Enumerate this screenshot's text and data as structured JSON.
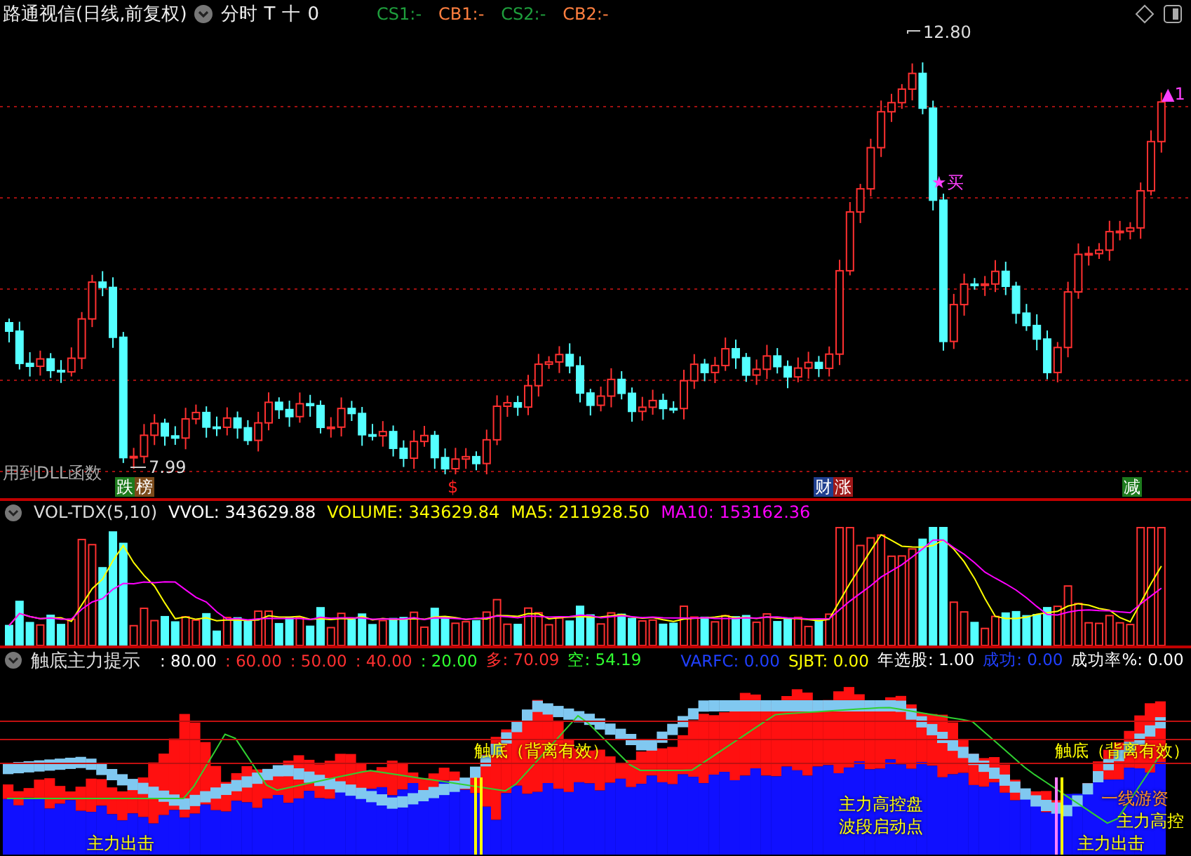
{
  "header": {
    "title": "路通视信(日线,前复权)",
    "tools": [
      "分时",
      "T",
      "十",
      "0"
    ],
    "values": [
      {
        "text": "CS1:-",
        "color": "#1e9e3c"
      },
      {
        "text": "CB1:-",
        "color": "#ff7f3f"
      },
      {
        "text": "CS2:-",
        "color": "#1e9e3c"
      },
      {
        "text": "CB2:-",
        "color": "#ff7f3f"
      }
    ]
  },
  "price_chart": {
    "high_label": "12.80",
    "low_label": "7.99",
    "buy_signal": "★买",
    "up_signal": "▲1",
    "note": "用到DLL函数",
    "markers": [
      {
        "kind": "badge",
        "text": "跌",
        "color": "#1d7a1d"
      },
      {
        "kind": "badge",
        "text": "榜",
        "color": "#7a4a1a"
      },
      {
        "kind": "plain",
        "text": "$",
        "color": "#ff2020"
      },
      {
        "kind": "badge",
        "text": "财",
        "color": "#1f3f8f"
      },
      {
        "kind": "badge",
        "text": "涨",
        "color": "#a01818"
      },
      {
        "kind": "badge",
        "text": "减",
        "color": "#1d7a1d"
      }
    ]
  },
  "volume_panel": {
    "title": "VOL-TDX(5,10)",
    "readouts": [
      {
        "text": "VVOL: 343629.88",
        "color": "#ffffff"
      },
      {
        "text": "VOLUME: 343629.84",
        "color": "#ffff00"
      },
      {
        "text": "MA5: 211928.50",
        "color": "#ffff00"
      },
      {
        "text": "MA10: 153162.36",
        "color": "#ff00ff"
      }
    ]
  },
  "indicator_panel": {
    "title": "触底主力提示",
    "readouts": [
      {
        "text": ": 80.00",
        "color": "#ffffff"
      },
      {
        "text": ": 60.00",
        "color": "#ff3030"
      },
      {
        "text": ": 50.00",
        "color": "#ff3030"
      },
      {
        "text": ": 40.00",
        "color": "#ff3030"
      },
      {
        "text": ": 20.00",
        "color": "#30ff30"
      },
      {
        "text": "多: 70.09",
        "color": "#ff3030"
      },
      {
        "text": "空: 54.19",
        "color": "#30ff30"
      },
      {
        "text": "VARFC: 0.00",
        "color": "#2040ff"
      },
      {
        "text": "SJBT: 0.00",
        "color": "#ffff00"
      },
      {
        "text": "年选股: 1.00",
        "color": "#ffffff"
      },
      {
        "text": "成功: 0.00",
        "color": "#2040ff"
      },
      {
        "text": "成功率%: 0.00",
        "color": "#ffffff"
      }
    ],
    "annotations": [
      {
        "text": "触底（背离有效）",
        "color": "#ffff00"
      },
      {
        "text": "主力出击",
        "color": "#ffff00"
      },
      {
        "text": "主力高控盘",
        "color": "#ffff00"
      },
      {
        "text": "波段启动点",
        "color": "#ffff00"
      },
      {
        "text": "触底（背离有效）",
        "color": "#ffff00"
      },
      {
        "text": "一线游资",
        "color": "#ff9020"
      },
      {
        "text": "主力高控",
        "color": "#ffff00"
      },
      {
        "text": "主力出击",
        "color": "#ffff00"
      }
    ]
  }
}
